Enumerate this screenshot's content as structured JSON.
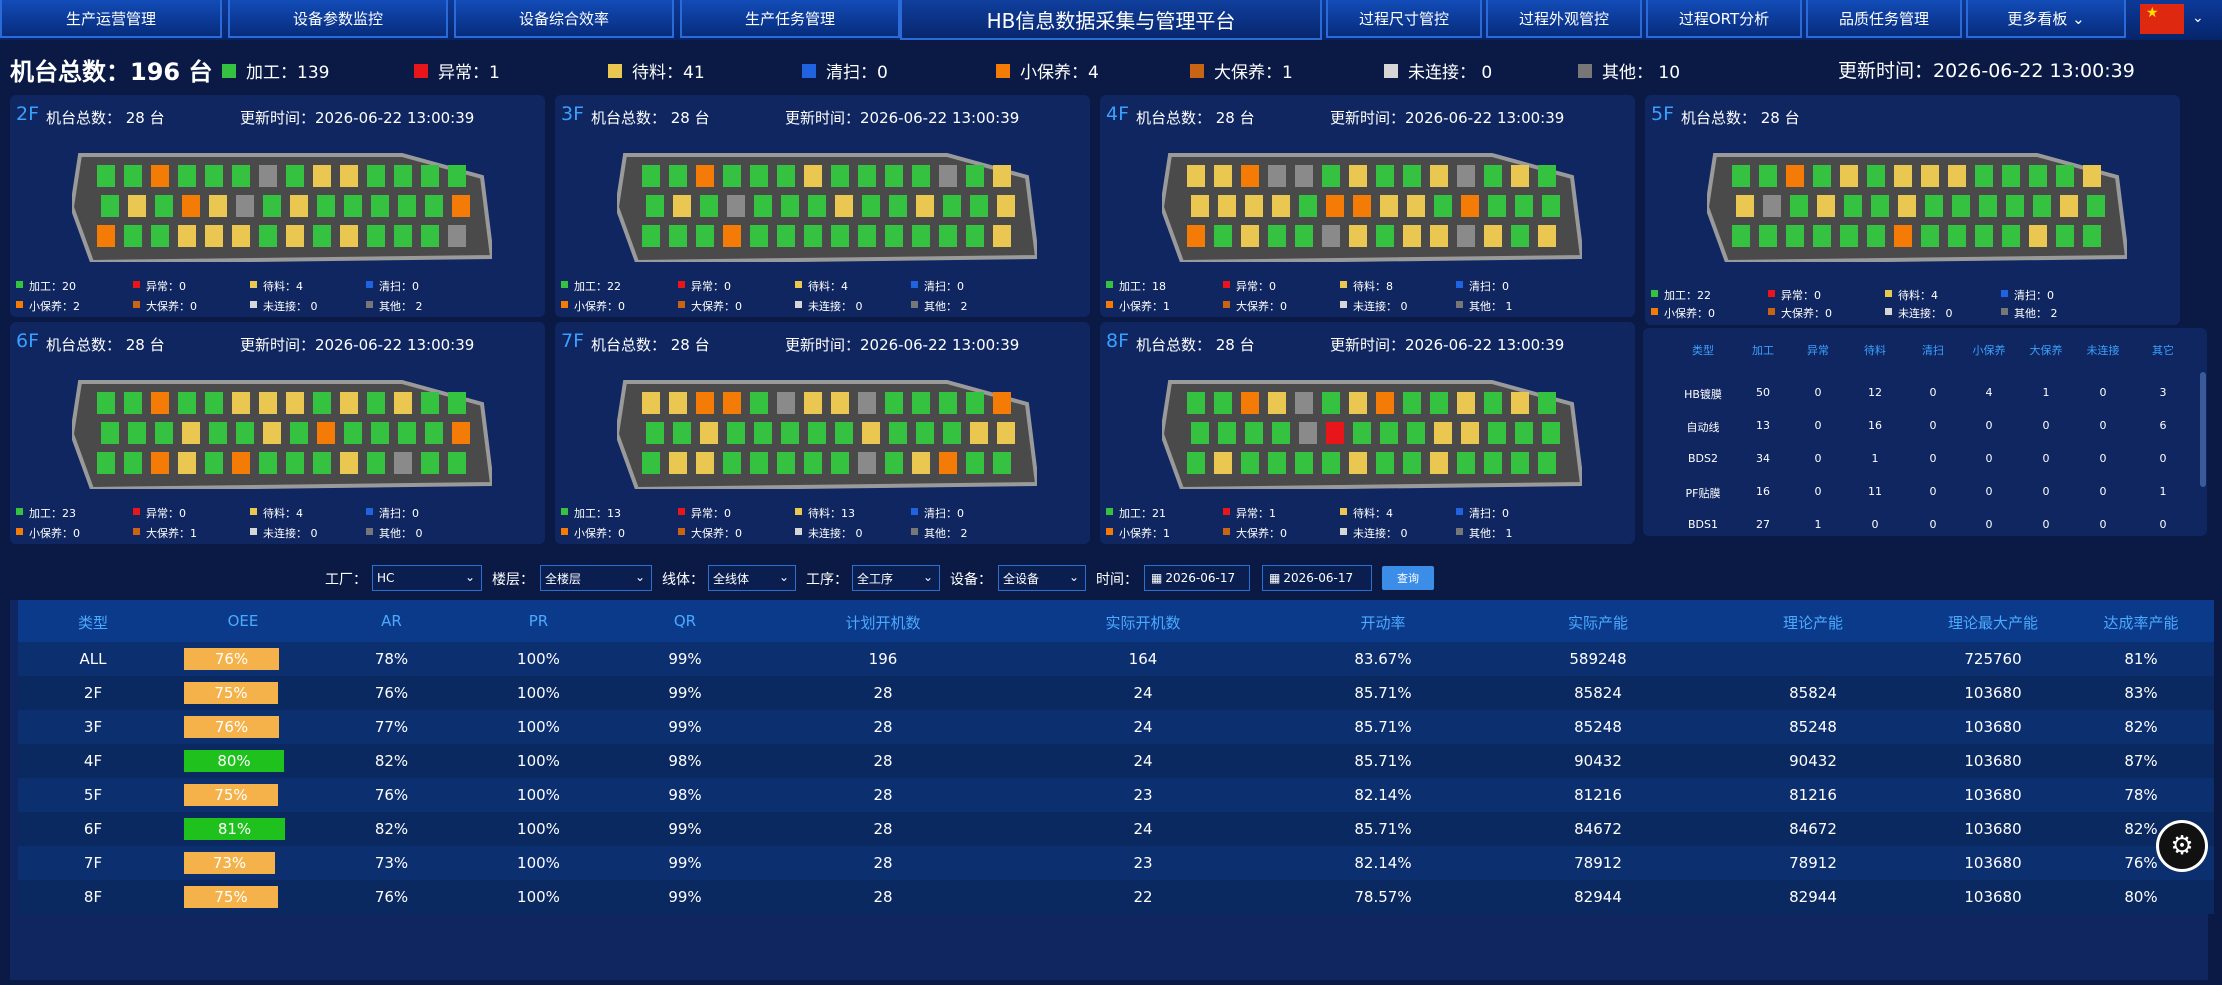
{
  "nav": {
    "left_items": [
      "生产运营管理",
      "设备参数监控",
      "设备综合效率",
      "生产任务管理"
    ],
    "title": "HB信息数据采集与管理平台",
    "right_items": [
      "过程尺寸管控",
      "过程外观管控",
      "过程ORT分析",
      "品质任务管理",
      "更多看板 ⌄"
    ],
    "flag": "china-flag-icon"
  },
  "summary": {
    "total_label": "机台总数：",
    "total_value": "196 台",
    "update_label": "更新时间：2026-06-22 13:00:39",
    "legend": [
      {
        "label": "加工：139",
        "color": "#34c240"
      },
      {
        "label": "异常：1",
        "color": "#e8151b"
      },
      {
        "label": "待料：41",
        "color": "#e9c750"
      },
      {
        "label": "清扫：0",
        "color": "#1f63e0"
      },
      {
        "label": "小保养：4",
        "color": "#f57b07"
      },
      {
        "label": "大保养：1",
        "color": "#c86414"
      },
      {
        "label": "未连接：  0",
        "color": "#d6d6d6"
      },
      {
        "label": "其他：  10",
        "color": "#777777"
      }
    ]
  },
  "floors": [
    {
      "floor": "2F",
      "total": "机台总数： 28 台",
      "time": "更新时间：2026-06-22 13:00:39",
      "row1": [
        "加工：20",
        "异常：0",
        "待料：4",
        "清扫：0"
      ],
      "row2": [
        "小保养：2",
        "大保养：0",
        "未连接：  0",
        "其他：  2"
      ]
    },
    {
      "floor": "3F",
      "total": "机台总数： 28 台",
      "time": "更新时间：2026-06-22 13:00:39",
      "row1": [
        "加工：22",
        "异常：0",
        "待料：4",
        "清扫：0"
      ],
      "row2": [
        "小保养：0",
        "大保养：0",
        "未连接：  0",
        "其他：  2"
      ]
    },
    {
      "floor": "4F",
      "total": "机台总数： 28 台",
      "time": "更新时间：2026-06-22 13:00:39",
      "row1": [
        "加工：18",
        "异常：0",
        "待料：8",
        "清扫：0"
      ],
      "row2": [
        "小保养：1",
        "大保养：0",
        "未连接：  0",
        "其他：  1"
      ]
    },
    {
      "floor": "5F",
      "total": "机台总数： 28 台",
      "time": "更新时间：2026-06-22 13:00:39",
      "row1": [
        "加工：22",
        "异常：0",
        "待料：4",
        "清扫：0"
      ],
      "row2": [
        "小保养：0",
        "大保养：0",
        "未连接：  0",
        "其他：  2"
      ]
    },
    {
      "floor": "6F",
      "total": "机台总数： 28 台",
      "time": "更新时间：2026-06-22 13:00:39",
      "row1": [
        "加工：23",
        "异常：0",
        "待料：4",
        "清扫：0"
      ],
      "row2": [
        "小保养：0",
        "大保养：1",
        "未连接：  0",
        "其他：  0"
      ]
    },
    {
      "floor": "7F",
      "total": "机台总数： 28 台",
      "time": "更新时间：2026-06-22 13:00:39",
      "row1": [
        "加工：13",
        "异常：0",
        "待料：13",
        "清扫：0"
      ],
      "row2": [
        "小保养：0",
        "大保养：0",
        "未连接：  0",
        "其他：  2"
      ]
    },
    {
      "floor": "8F",
      "total": "机台总数： 28 台",
      "time": "更新时间：2026-06-22 13:00:39",
      "row1": [
        "加工：21",
        "异常：1",
        "待料：4",
        "清扫：0"
      ],
      "row2": [
        "小保养：1",
        "大保养：0",
        "未连接：  0",
        "其他：  1"
      ]
    }
  ],
  "mini_table": {
    "headers": [
      "类型",
      "加工",
      "异常",
      "待料",
      "清扫",
      "小保养",
      "大保养",
      "未连接",
      "其它"
    ],
    "rows": [
      [
        "HB镀膜",
        "50",
        "0",
        "12",
        "0",
        "4",
        "1",
        "0",
        "3"
      ],
      [
        "自动线",
        "13",
        "0",
        "16",
        "0",
        "0",
        "0",
        "0",
        "6"
      ],
      [
        "BDS2",
        "34",
        "0",
        "1",
        "0",
        "0",
        "0",
        "0",
        "0"
      ],
      [
        "PF贴膜",
        "16",
        "0",
        "11",
        "0",
        "0",
        "0",
        "0",
        "1"
      ],
      [
        "BDS1",
        "27",
        "1",
        "0",
        "0",
        "0",
        "0",
        "0",
        "0"
      ]
    ]
  },
  "filters": {
    "factory_label": "工厂：",
    "factory_value": "HC",
    "floor_label": "楼层：",
    "floor_value": "全楼层",
    "line_label": "线体：",
    "line_value": "全线体",
    "process_label": "工序：",
    "process_value": "全工序",
    "device_label": "设备：",
    "device_value": "全设备",
    "time_label": "时间：",
    "date_start": "2026-06-17",
    "date_end": "2026-06-17",
    "query_label": "查询"
  },
  "big_table": {
    "headers": [
      "类型",
      "OEE",
      "AR",
      "PR",
      "QR",
      "计划开机数",
      "实际开机数",
      "开动率",
      "实际产能",
      "理论产能",
      "理论最大产能",
      "达成率产能"
    ],
    "rows": [
      {
        "type": "ALL",
        "oee": "76%",
        "oee_value": 76,
        "ar": "78%",
        "pr": "100%",
        "qr": "99%",
        "plan": "196",
        "actual": "164",
        "rate": "83.67%",
        "real_cap": "589248",
        "theo_cap": "",
        "max_cap": "725760",
        "achieve": "81%"
      },
      {
        "type": "2F",
        "oee": "75%",
        "oee_value": 75,
        "ar": "76%",
        "pr": "100%",
        "qr": "99%",
        "plan": "28",
        "actual": "24",
        "rate": "85.71%",
        "real_cap": "85824",
        "theo_cap": "85824",
        "max_cap": "103680",
        "achieve": "83%"
      },
      {
        "type": "3F",
        "oee": "76%",
        "oee_value": 76,
        "ar": "77%",
        "pr": "100%",
        "qr": "99%",
        "plan": "28",
        "actual": "24",
        "rate": "85.71%",
        "real_cap": "85248",
        "theo_cap": "85248",
        "max_cap": "103680",
        "achieve": "82%"
      },
      {
        "type": "4F",
        "oee": "80%",
        "oee_value": 80,
        "ar": "82%",
        "pr": "100%",
        "qr": "98%",
        "plan": "28",
        "actual": "24",
        "rate": "85.71%",
        "real_cap": "90432",
        "theo_cap": "90432",
        "max_cap": "103680",
        "achieve": "87%"
      },
      {
        "type": "5F",
        "oee": "75%",
        "oee_value": 75,
        "ar": "76%",
        "pr": "100%",
        "qr": "98%",
        "plan": "28",
        "actual": "23",
        "rate": "82.14%",
        "real_cap": "81216",
        "theo_cap": "81216",
        "max_cap": "103680",
        "achieve": "78%"
      },
      {
        "type": "6F",
        "oee": "81%",
        "oee_value": 81,
        "ar": "82%",
        "pr": "100%",
        "qr": "99%",
        "plan": "28",
        "actual": "24",
        "rate": "85.71%",
        "real_cap": "84672",
        "theo_cap": "84672",
        "max_cap": "103680",
        "achieve": "82%"
      },
      {
        "type": "7F",
        "oee": "73%",
        "oee_value": 73,
        "ar": "73%",
        "pr": "100%",
        "qr": "99%",
        "plan": "28",
        "actual": "23",
        "rate": "82.14%",
        "real_cap": "78912",
        "theo_cap": "78912",
        "max_cap": "103680",
        "achieve": "76%"
      },
      {
        "type": "8F",
        "oee": "75%",
        "oee_value": 75,
        "ar": "76%",
        "pr": "100%",
        "qr": "99%",
        "plan": "28",
        "actual": "22",
        "rate": "78.57%",
        "real_cap": "82944",
        "theo_cap": "82944",
        "max_cap": "103680",
        "achieve": "80%"
      }
    ],
    "oee_colors": {
      "high": "#1fc11c",
      "normal": "#f6b24a"
    }
  },
  "settings_icon": "gear-icon"
}
